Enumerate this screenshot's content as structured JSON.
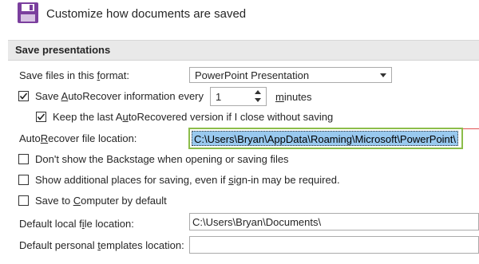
{
  "header": {
    "title": "Customize how documents are saved",
    "icon": "floppy-disk-icon",
    "icon_color": "#7b3f9e"
  },
  "section": {
    "title": "Save presentations"
  },
  "save_format": {
    "label_pre": "Save files in this ",
    "label_ul": "f",
    "label_post": "ormat:",
    "value": "PowerPoint Presentation"
  },
  "autorecover": {
    "checked": true,
    "label_pre": "Save ",
    "label_ul": "A",
    "label_post": "utoRecover information every",
    "minutes_value": "1",
    "minutes_ul": "m",
    "minutes_post": "inutes"
  },
  "keep_last": {
    "checked": true,
    "label_pre": "Keep the last A",
    "label_ul": "u",
    "label_post": "toRecovered version if I close without saving"
  },
  "autorecover_location": {
    "label_pre": "Auto",
    "label_ul": "R",
    "label_post": "ecover file location:",
    "value": "C:\\Users\\Bryan\\AppData\\Roaming\\Microsoft\\PowerPoint\\",
    "highlight_color": "#8cbd4a"
  },
  "backstage": {
    "checked": false,
    "label_pre": "Don't show the Backstage when opening or saving files"
  },
  "additional_places": {
    "checked": false,
    "label_pre": "Show additional places for saving, even if ",
    "label_ul": "s",
    "label_post": "ign-in may be required."
  },
  "save_computer": {
    "checked": false,
    "label_pre": "Save to ",
    "label_ul": "C",
    "label_post": "omputer by default"
  },
  "default_local": {
    "label_pre": "Default local f",
    "label_ul": "i",
    "label_post": "le location:",
    "value": "C:\\Users\\Bryan\\Documents\\"
  },
  "default_templates": {
    "label_pre": "Default personal ",
    "label_ul": "t",
    "label_post": "emplates location:",
    "value": ""
  }
}
